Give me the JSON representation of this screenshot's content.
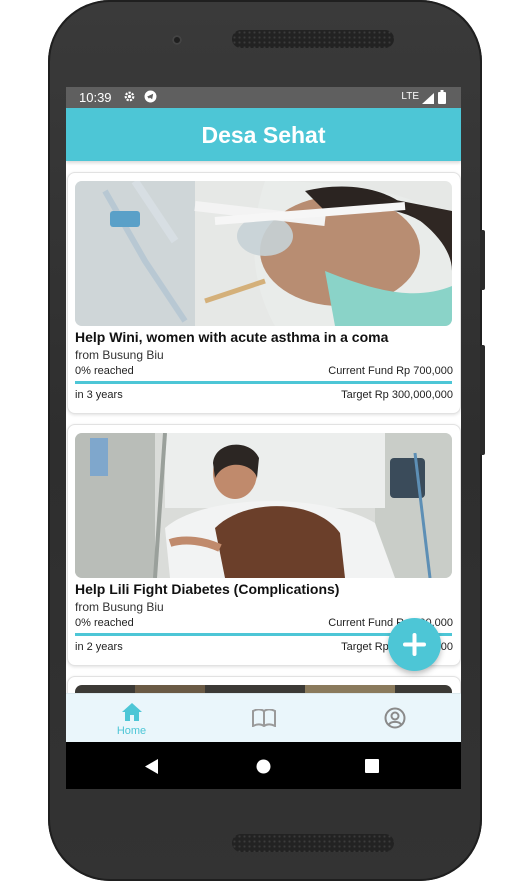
{
  "status_bar": {
    "time": "10:39",
    "network": "LTE",
    "icons": [
      "settings-icon",
      "telegram-icon",
      "signal-icon",
      "battery-icon"
    ]
  },
  "app_bar": {
    "title": "Desa Sehat"
  },
  "campaigns": [
    {
      "title": "Help Wini, women with acute asthma in a coma",
      "location": "from Busung Biu",
      "progress_label": "0% reached",
      "progress_fraction": 0.0,
      "current_fund": "Current Fund Rp 700,000",
      "duration": "in 3 years",
      "target": "Target Rp 300,000,000"
    },
    {
      "title": "Help Lili Fight Diabetes (Complications)",
      "location": "from Busung Biu",
      "progress_label": "0% reached",
      "progress_fraction": 0.0,
      "current_fund": "Current Fund Rp 700,000",
      "duration": "in 2 years",
      "target": "Target Rp 300,000,000"
    }
  ],
  "bottom_nav": {
    "items": [
      {
        "label": "Home",
        "icon": "home-icon",
        "active": true
      },
      {
        "label": "",
        "icon": "book-icon",
        "active": false
      },
      {
        "label": "",
        "icon": "account-icon",
        "active": false
      }
    ]
  },
  "fab": {
    "icon": "plus-icon"
  },
  "colors": {
    "primary": "#4dc6d6",
    "status_bar": "#5f5f5f",
    "nav_background": "#eaf6fb",
    "inactive_icon": "#9a9a9a"
  }
}
